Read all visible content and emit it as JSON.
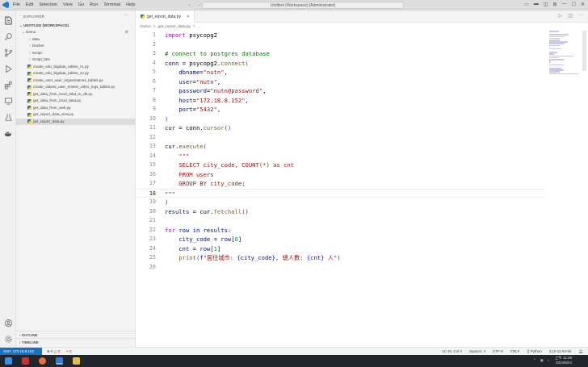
{
  "window": {
    "title": "Untitled (Workspace) [Administrator]",
    "menu": [
      "File",
      "Edit",
      "Selection",
      "View",
      "Go",
      "Run",
      "Terminal",
      "Help"
    ]
  },
  "explorer": {
    "title": "EXPLORER",
    "workspace": "UNTITLED (WORKSPACE)",
    "root": "Demo",
    "folders": [
      "data",
      "Docker",
      "Script",
      "Script_btm"
    ],
    "files": [
      "create_edu_bigdata_tables_v1.py",
      "create_edu_bigdata_tables_v2.py",
      "create_user_user_organizations_tables.py",
      "create_videos_user_review_video_logs_tables.py",
      "get_data_from_local_data_to_db.py",
      "get_data_from_local_data.py",
      "get_data_from_web.py",
      "get_report_data_view.py",
      "get_report_data.py"
    ],
    "selected_file": "get_report_data.py",
    "outline": "OUTLINE",
    "timeline": "TIMELINE"
  },
  "editor": {
    "tab_label": "get_report_data.py",
    "breadcrumb": [
      "Demo",
      ">",
      "get_report_data.py",
      ">",
      "..."
    ],
    "current_line": 18,
    "lines": [
      {
        "n": "1",
        "tokens": [
          [
            "kw",
            "import"
          ],
          [
            "plain",
            " psycopg2"
          ]
        ]
      },
      {
        "n": "2",
        "tokens": []
      },
      {
        "n": "3",
        "tokens": [
          [
            "cm",
            "# connect to postgres database"
          ]
        ]
      },
      {
        "n": "4",
        "tokens": [
          [
            "var",
            "conn"
          ],
          [
            "plain",
            " = psycopg2."
          ],
          [
            "fn",
            "connect"
          ],
          [
            "brk",
            "("
          ]
        ]
      },
      {
        "n": "5",
        "tokens": [
          [
            "plain",
            "    "
          ],
          [
            "var",
            "dbname"
          ],
          [
            "plain",
            "="
          ],
          [
            "str",
            "\"nutn\""
          ],
          [
            "plain",
            ","
          ]
        ]
      },
      {
        "n": "6",
        "tokens": [
          [
            "plain",
            "    "
          ],
          [
            "var",
            "user"
          ],
          [
            "plain",
            "="
          ],
          [
            "str",
            "\"nutn\""
          ],
          [
            "plain",
            ","
          ]
        ]
      },
      {
        "n": "7",
        "tokens": [
          [
            "plain",
            "    "
          ],
          [
            "var",
            "password"
          ],
          [
            "plain",
            "="
          ],
          [
            "str",
            "\"nutn@password\""
          ],
          [
            "plain",
            ","
          ]
        ]
      },
      {
        "n": "8",
        "tokens": [
          [
            "plain",
            "    "
          ],
          [
            "var",
            "host"
          ],
          [
            "plain",
            "="
          ],
          [
            "str",
            "\"172.18.8.152\""
          ],
          [
            "plain",
            ","
          ]
        ]
      },
      {
        "n": "9",
        "tokens": [
          [
            "plain",
            "    "
          ],
          [
            "var",
            "port"
          ],
          [
            "plain",
            "="
          ],
          [
            "str",
            "\"5432\""
          ],
          [
            "plain",
            ","
          ]
        ]
      },
      {
        "n": "10",
        "tokens": [
          [
            "brk",
            ")"
          ]
        ]
      },
      {
        "n": "11",
        "tokens": [
          [
            "var",
            "cur"
          ],
          [
            "plain",
            " = conn."
          ],
          [
            "fn",
            "cursor"
          ],
          [
            "brk",
            "()"
          ]
        ]
      },
      {
        "n": "12",
        "tokens": []
      },
      {
        "n": "13",
        "tokens": [
          [
            "var",
            "cur"
          ],
          [
            "plain",
            "."
          ],
          [
            "fn",
            "execute"
          ],
          [
            "brk",
            "("
          ]
        ]
      },
      {
        "n": "14",
        "tokens": [
          [
            "str",
            "    \"\"\""
          ]
        ]
      },
      {
        "n": "15",
        "tokens": [
          [
            "str",
            "    SELECT city_code, COUNT(*) as cnt"
          ]
        ]
      },
      {
        "n": "16",
        "tokens": [
          [
            "str",
            "    FROM users"
          ]
        ]
      },
      {
        "n": "17",
        "tokens": [
          [
            "str",
            "    GROUP BY city_code;"
          ]
        ]
      },
      {
        "n": "18",
        "tokens": [
          [
            "str",
            "\"\"\""
          ]
        ]
      },
      {
        "n": "19",
        "tokens": [
          [
            "brk",
            ")"
          ]
        ]
      },
      {
        "n": "20",
        "tokens": [
          [
            "var",
            "results"
          ],
          [
            "plain",
            " = cur."
          ],
          [
            "fn",
            "fetchall"
          ],
          [
            "brk",
            "()"
          ]
        ]
      },
      {
        "n": "21",
        "tokens": []
      },
      {
        "n": "22",
        "tokens": [
          [
            "kw",
            "for"
          ],
          [
            "plain",
            " "
          ],
          [
            "var",
            "row"
          ],
          [
            "plain",
            " "
          ],
          [
            "kb",
            "in"
          ],
          [
            "plain",
            " "
          ],
          [
            "var",
            "results"
          ],
          [
            "plain",
            ":"
          ]
        ]
      },
      {
        "n": "23",
        "tokens": [
          [
            "plain",
            "    "
          ],
          [
            "var",
            "city_code"
          ],
          [
            "plain",
            " = "
          ],
          [
            "var",
            "row"
          ],
          [
            "plain",
            "["
          ],
          [
            "num",
            "0"
          ],
          [
            "plain",
            "]"
          ]
        ]
      },
      {
        "n": "24",
        "tokens": [
          [
            "plain",
            "    "
          ],
          [
            "var",
            "cnt"
          ],
          [
            "plain",
            " = "
          ],
          [
            "var",
            "row"
          ],
          [
            "plain",
            "["
          ],
          [
            "num",
            "1"
          ],
          [
            "plain",
            "]"
          ]
        ]
      },
      {
        "n": "25",
        "tokens": [
          [
            "plain",
            "    "
          ],
          [
            "fn",
            "print"
          ],
          [
            "brk",
            "("
          ],
          [
            "kb",
            "f"
          ],
          [
            "str",
            "\"居住城市: "
          ],
          [
            "kb",
            "{"
          ],
          [
            "var",
            "city_code"
          ],
          [
            "kb",
            "}"
          ],
          [
            "str",
            ", 總人數: "
          ],
          [
            "kb",
            "{"
          ],
          [
            "var",
            "cnt"
          ],
          [
            "kb",
            "}"
          ],
          [
            "str",
            " 人\""
          ],
          [
            "brk",
            ")"
          ]
        ]
      },
      {
        "n": "26",
        "tokens": []
      }
    ]
  },
  "status": {
    "remote": "SSH: 172.18.8.152",
    "problems": "⊗ 0 △ 0",
    "ports": "⑂ 0",
    "cursor": "Ln 18, Col 4",
    "spaces": "Spaces: 4",
    "encoding": "UTF-8",
    "eol": "CRLF",
    "language": "{} Python",
    "interpreter": "3.10.12 64-bit"
  },
  "taskbar": {
    "time": "上午 11:39",
    "date": "2024/8/24"
  },
  "colors": {
    "accent": "#1672c3",
    "keyword": "#af00db",
    "string": "#a31515",
    "comment": "#008000"
  }
}
